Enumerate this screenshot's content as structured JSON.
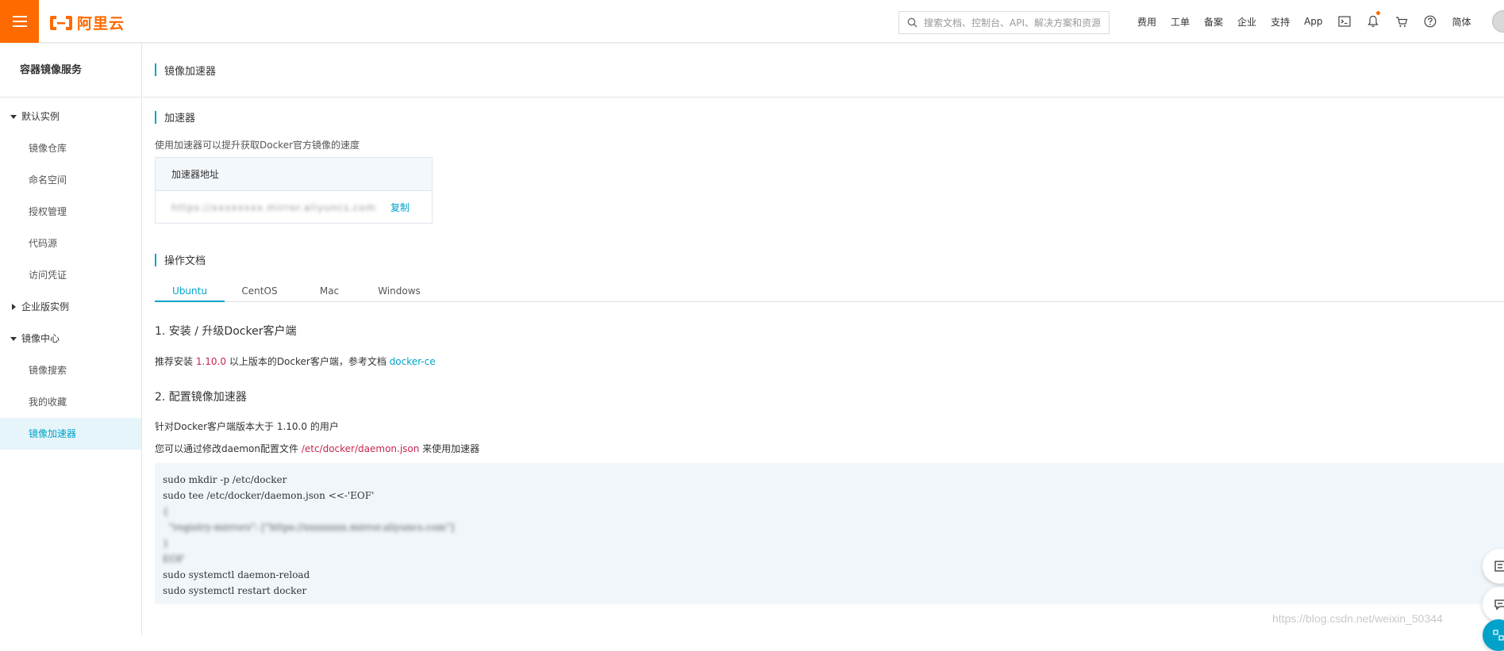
{
  "header": {
    "logo_text": "阿里云",
    "search_placeholder": "搜索文档、控制台、API、解决方案和资源",
    "nav": [
      "费用",
      "工单",
      "备案",
      "企业",
      "支持",
      "App"
    ],
    "lang": "简体",
    "brand_color": "#ff6a00"
  },
  "sidebar": {
    "title": "容器镜像服务",
    "groups": [
      {
        "label": "默认实例",
        "expanded": true,
        "items": [
          "镜像仓库",
          "命名空间",
          "授权管理",
          "代码源",
          "访问凭证"
        ]
      },
      {
        "label": "企业版实例",
        "expanded": false,
        "items": []
      },
      {
        "label": "镜像中心",
        "expanded": true,
        "items": [
          "镜像搜索",
          "我的收藏",
          "镜像加速器"
        ]
      }
    ],
    "active_item": "镜像加速器"
  },
  "page": {
    "title": "镜像加速器",
    "accelerator": {
      "title": "加速器",
      "desc": "使用加速器可以提升获取Docker官方镜像的速度",
      "table_header": "加速器地址",
      "address_redacted": "https://xxxxxxxx.mirror.aliyuncs.com",
      "copy_label": "复制"
    },
    "docs": {
      "title": "操作文档",
      "tabs": [
        "Ubuntu",
        "CentOS",
        "Mac",
        "Windows"
      ],
      "active_tab": "Ubuntu",
      "step1_title": "1. 安装 / 升级Docker客户端",
      "step1_text_pre": "推荐安装 ",
      "step1_version": "1.10.0",
      "step1_text_mid": " 以上版本的Docker客户端，参考文档 ",
      "step1_link": "docker-ce",
      "step2_title": "2. 配置镜像加速器",
      "for_users": "针对Docker客户端版本大于 1.10.0 的用户",
      "daemon_pre": "您可以通过修改daemon配置文件 ",
      "daemon_path": "/etc/docker/daemon.json",
      "daemon_post": " 来使用加速器",
      "code_lines": [
        "sudo mkdir -p /etc/docker",
        "sudo tee /etc/docker/daemon.json <<-'EOF'",
        "{",
        "  \"registry-mirrors\": [\"https://xxxxxxxx.mirror.aliyuncs.com\"]",
        "}",
        "EOF",
        "sudo systemctl daemon-reload",
        "sudo systemctl restart docker"
      ],
      "blurred_lines": [
        2,
        3,
        4,
        5
      ]
    }
  },
  "watermark": "https://blog.csdn.net/weixin_50344"
}
